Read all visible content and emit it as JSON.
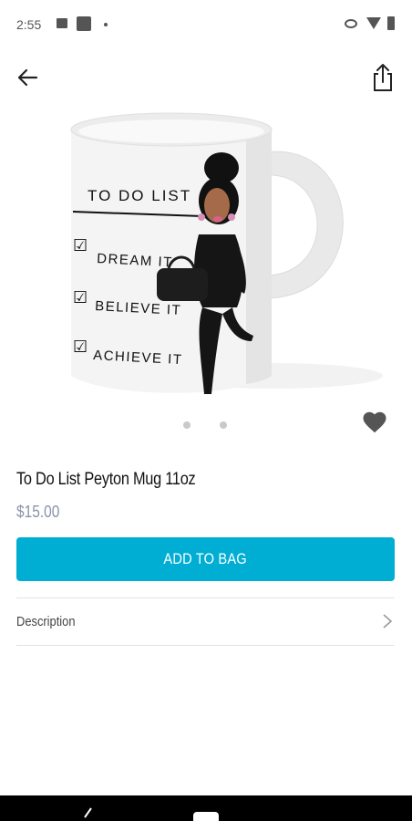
{
  "status_bar": {
    "time": "2:55",
    "icons": [
      "image-icon",
      "square-icon",
      "dot-icon",
      "eye-icon",
      "wifi-icon",
      "battery-icon"
    ]
  },
  "header": {
    "back_icon": "arrow-left-icon",
    "share_icon": "share-icon"
  },
  "product": {
    "mug_text": {
      "heading": "TO DO LIST",
      "items": [
        "DREAM IT",
        "BELIEVE IT",
        "ACHIEVE IT"
      ]
    },
    "carousel_dots": 2,
    "favorite_icon": "heart-icon",
    "title": "To Do List Peyton Mug 11oz",
    "price": "$15.00",
    "add_to_bag_label": "ADD TO BAG",
    "description_label": "Description",
    "description_icon": "chevron-right-icon"
  },
  "colors": {
    "accent": "#00aed3",
    "price": "#8a94a8",
    "divider": "#e3e3e3"
  },
  "nav": {
    "back_icon": "nav-back-icon",
    "home_icon": "nav-home-icon"
  }
}
